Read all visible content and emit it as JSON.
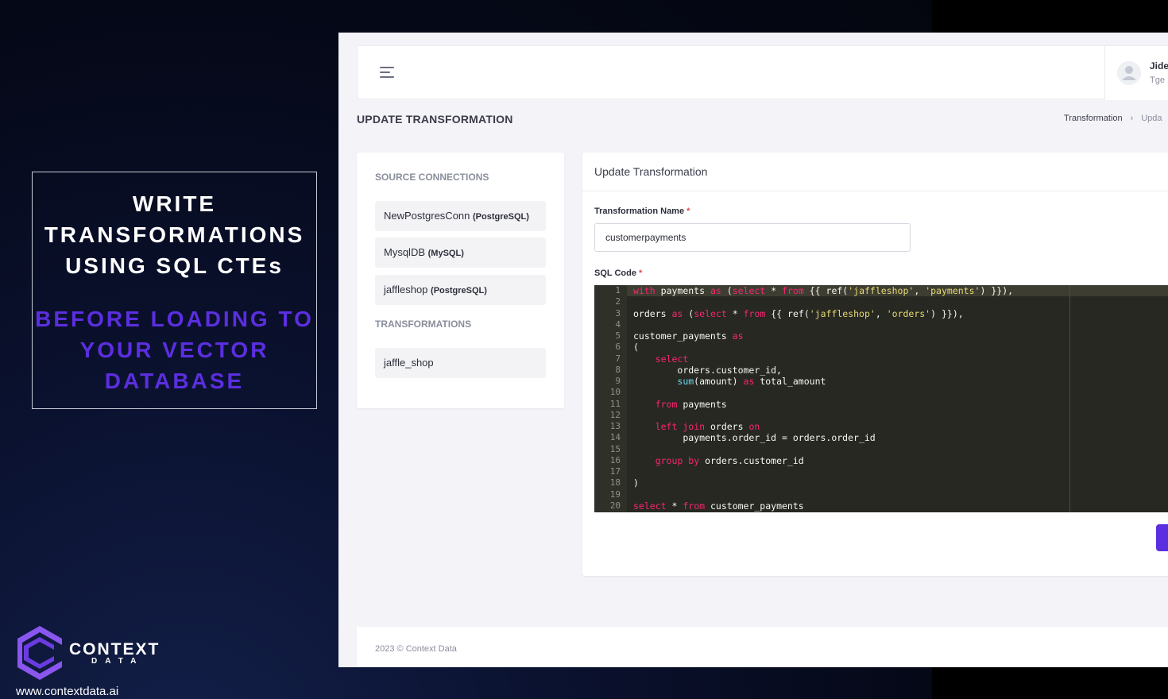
{
  "promo": {
    "headline": "WRITE TRANSFORMATIONS USING SQL CTEs",
    "subheadline": "BEFORE LOADING TO YOUR VECTOR DATABASE"
  },
  "brand": {
    "name": "CONTEXT",
    "sub": "DATA",
    "website": "www.contextdata.ai",
    "accent": "#5b2ee0"
  },
  "topbar": {
    "menu_icon": "hamburger-menu-icon",
    "user_name": "Jide",
    "user_role": "Tge I"
  },
  "page": {
    "title": "UPDATE TRANSFORMATION",
    "breadcrumb": [
      "Transformation",
      "Upda"
    ]
  },
  "sidebar": {
    "source_heading": "SOURCE CONNECTIONS",
    "connections": [
      {
        "name": "NewPostgresConn",
        "type": "(PostgreSQL)"
      },
      {
        "name": "MysqlDB",
        "type": "(MySQL)"
      },
      {
        "name": "jaffleshop",
        "type": "(PostgreSQL)"
      }
    ],
    "transformations_heading": "TRANSFORMATIONS",
    "transformations": [
      "jaffle_shop"
    ]
  },
  "form": {
    "card_title": "Update Transformation",
    "name_label": "Transformation Name",
    "name_value": "customerpayments",
    "sql_label": "SQL Code",
    "required_mark": "*"
  },
  "editor": {
    "line_numbers": [
      "1",
      "2",
      "3",
      "4",
      "5",
      "6",
      "7",
      "8",
      "9",
      "10",
      "11",
      "12",
      "13",
      "14",
      "15",
      "16",
      "17",
      "18",
      "19",
      "20"
    ],
    "lines": [
      "with payments as (select * from {{ ref('jaffleshop', 'payments') }}),",
      "",
      "orders as (select * from {{ ref('jaffleshop', 'orders') }}),",
      "",
      "customer_payments as",
      "(",
      "    select",
      "        orders.customer_id,",
      "        sum(amount) as total_amount",
      "",
      "    from payments",
      "",
      "    left join orders on",
      "         payments.order_id = orders.order_id",
      "",
      "    group by orders.customer_id",
      "",
      ")",
      "",
      "select * from customer_payments"
    ]
  },
  "footer": {
    "text": "2023 © Context Data"
  }
}
